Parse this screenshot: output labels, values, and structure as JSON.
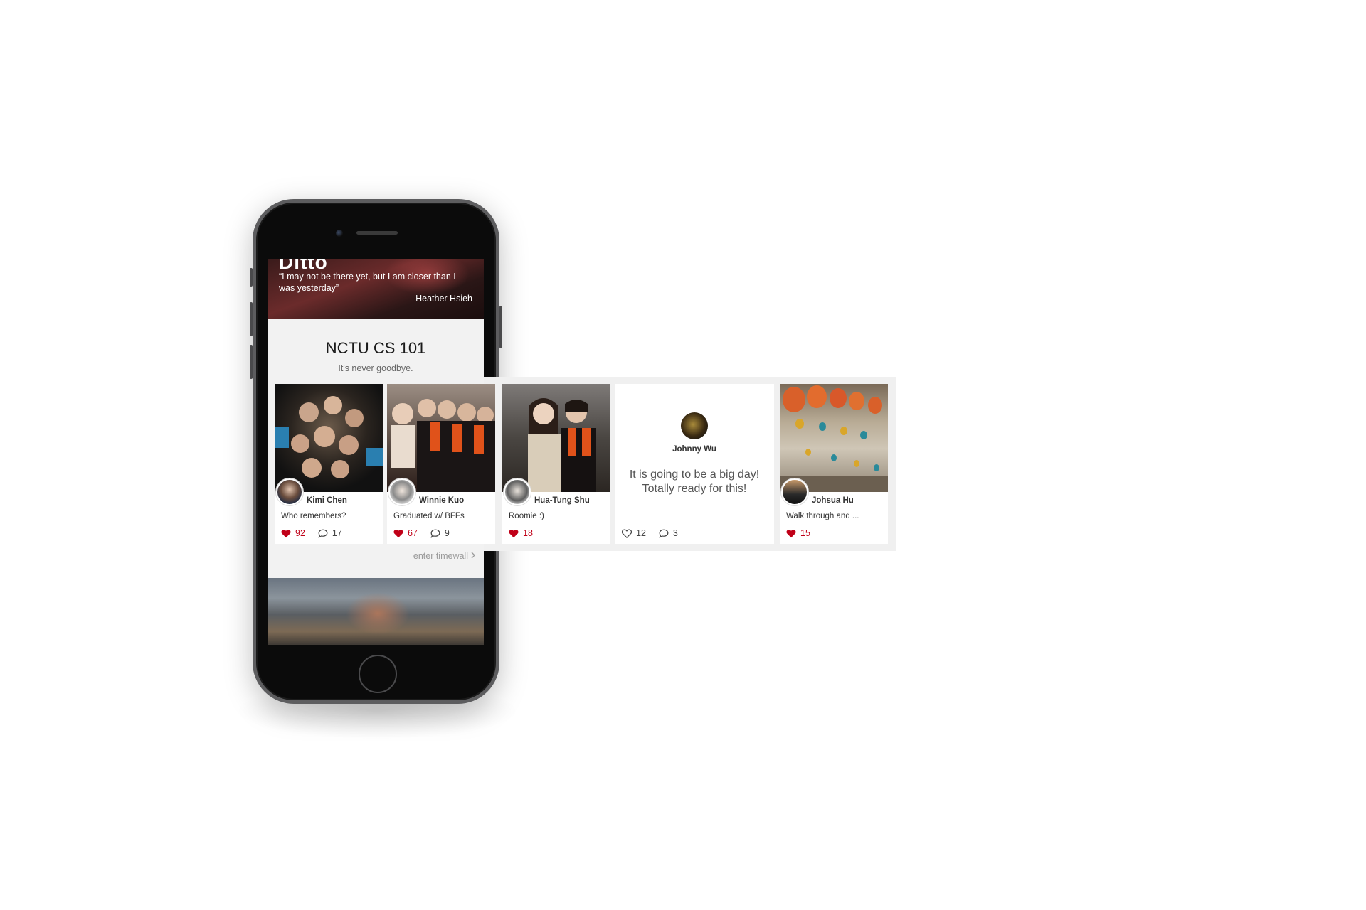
{
  "hero": {
    "wordmark": "Ditto",
    "quote": "“I may not be there yet, but I am closer than I was yesterday”",
    "author": "— Heather Hsieh"
  },
  "section": {
    "title": "NCTU CS 101",
    "subtitle": "It's never goodbye.",
    "enter_label": "enter timewall"
  },
  "cards": [
    {
      "author": "Kimi Chen",
      "caption": "Who remembers?",
      "likes": "92",
      "comments": "17"
    },
    {
      "author": "Winnie Kuo",
      "caption": "Graduated w/ BFFs",
      "likes": "67",
      "comments": "9"
    },
    {
      "author": "Hua-Tung Shu",
      "caption": "Roomie :)",
      "likes": "18"
    },
    {
      "author": "Johnny Wu",
      "text": "It is going to be a big day! Totally ready for this!",
      "likes": "12",
      "comments": "3"
    },
    {
      "author": "Johsua Hu",
      "caption": "Walk through and ...",
      "likes": "15"
    }
  ],
  "colors": {
    "like_red": "#c00018",
    "strip_bg": "#f0f0f0",
    "screen_bg": "#f2f2f2"
  },
  "icons": [
    "heart-icon",
    "heart-outline-icon",
    "comment-icon",
    "chevron-right-icon"
  ]
}
